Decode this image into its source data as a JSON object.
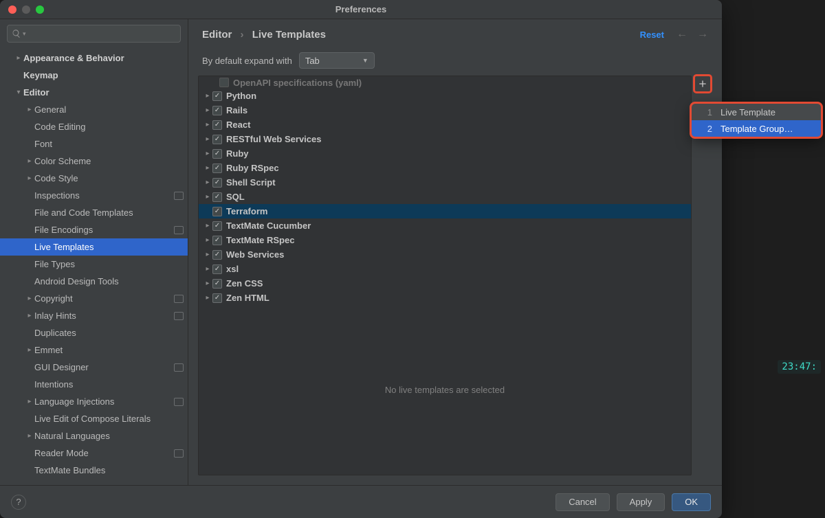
{
  "window": {
    "title": "Preferences"
  },
  "search": {
    "placeholder": ""
  },
  "sidebar": {
    "items": [
      {
        "label": "Appearance & Behavior",
        "indent": 0,
        "chev": "right",
        "bold": true
      },
      {
        "label": "Keymap",
        "indent": 0,
        "chev": "",
        "bold": true
      },
      {
        "label": "Editor",
        "indent": 0,
        "chev": "down",
        "bold": true
      },
      {
        "label": "General",
        "indent": 1,
        "chev": "right"
      },
      {
        "label": "Code Editing",
        "indent": 1,
        "chev": ""
      },
      {
        "label": "Font",
        "indent": 1,
        "chev": ""
      },
      {
        "label": "Color Scheme",
        "indent": 1,
        "chev": "right"
      },
      {
        "label": "Code Style",
        "indent": 1,
        "chev": "right"
      },
      {
        "label": "Inspections",
        "indent": 1,
        "chev": "",
        "badge": true
      },
      {
        "label": "File and Code Templates",
        "indent": 1,
        "chev": ""
      },
      {
        "label": "File Encodings",
        "indent": 1,
        "chev": "",
        "badge": true
      },
      {
        "label": "Live Templates",
        "indent": 1,
        "chev": "",
        "selected": true
      },
      {
        "label": "File Types",
        "indent": 1,
        "chev": ""
      },
      {
        "label": "Android Design Tools",
        "indent": 1,
        "chev": ""
      },
      {
        "label": "Copyright",
        "indent": 1,
        "chev": "right",
        "badge": true
      },
      {
        "label": "Inlay Hints",
        "indent": 1,
        "chev": "right",
        "badge": true
      },
      {
        "label": "Duplicates",
        "indent": 1,
        "chev": ""
      },
      {
        "label": "Emmet",
        "indent": 1,
        "chev": "right"
      },
      {
        "label": "GUI Designer",
        "indent": 1,
        "chev": "",
        "badge": true
      },
      {
        "label": "Intentions",
        "indent": 1,
        "chev": ""
      },
      {
        "label": "Language Injections",
        "indent": 1,
        "chev": "right",
        "badge": true
      },
      {
        "label": "Live Edit of Compose Literals",
        "indent": 1,
        "chev": ""
      },
      {
        "label": "Natural Languages",
        "indent": 1,
        "chev": "right"
      },
      {
        "label": "Reader Mode",
        "indent": 1,
        "chev": "",
        "badge": true
      },
      {
        "label": "TextMate Bundles",
        "indent": 1,
        "chev": ""
      }
    ]
  },
  "breadcrumb": {
    "a": "Editor",
    "b": "Live Templates"
  },
  "reset_label": "Reset",
  "expand": {
    "label": "By default expand with",
    "value": "Tab"
  },
  "template_groups": [
    {
      "label": "Python",
      "chev": true
    },
    {
      "label": "Rails",
      "chev": true
    },
    {
      "label": "React",
      "chev": true
    },
    {
      "label": "RESTful Web Services",
      "chev": true
    },
    {
      "label": "Ruby",
      "chev": true
    },
    {
      "label": "Ruby RSpec",
      "chev": true
    },
    {
      "label": "Shell Script",
      "chev": true
    },
    {
      "label": "SQL",
      "chev": true
    },
    {
      "label": "Terraform",
      "chev": false,
      "selected": true
    },
    {
      "label": "TextMate Cucumber",
      "chev": true
    },
    {
      "label": "TextMate RSpec",
      "chev": true
    },
    {
      "label": "Web Services",
      "chev": true
    },
    {
      "label": "xsl",
      "chev": true
    },
    {
      "label": "Zen CSS",
      "chev": true
    },
    {
      "label": "Zen HTML",
      "chev": true
    }
  ],
  "partial_top_label": "OpenAPI specifications (yaml)",
  "empty_message": "No live templates are selected",
  "popup": {
    "items": [
      {
        "num": "1",
        "label": "Live Template"
      },
      {
        "num": "2",
        "label": "Template Group…",
        "selected": true
      }
    ]
  },
  "footer": {
    "cancel": "Cancel",
    "apply": "Apply",
    "ok": "OK"
  },
  "bg_clock": "23:47:"
}
